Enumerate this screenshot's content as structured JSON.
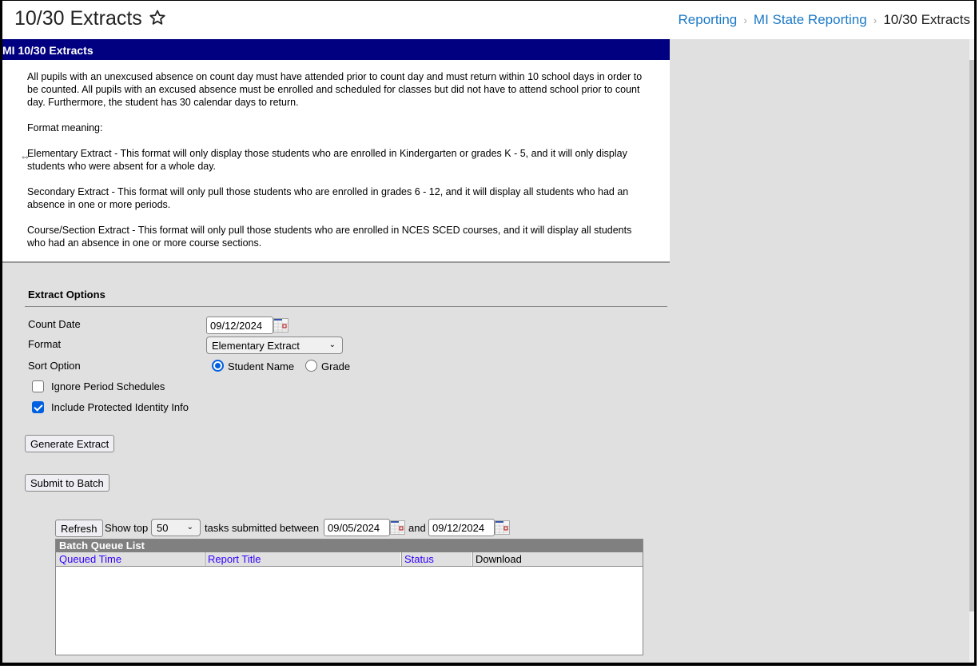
{
  "header": {
    "title": "10/30 Extracts",
    "favorite_icon": "star-outline-icon",
    "breadcrumb": [
      {
        "label": "Reporting"
      },
      {
        "label": "MI State Reporting"
      },
      {
        "label": "10/30 Extracts"
      }
    ],
    "breadcrumb_separator": "›"
  },
  "description": {
    "panel_title": "MI 10/30 Extracts",
    "paragraphs": [
      "All pupils with an unexcused absence on count day must have attended prior to count day and must return within 10 school days in order to be counted. All pupils with an excused absence must be enrolled and scheduled for classes but did not have to attend school prior to count day. Furthermore, the student has 30 calendar days to return.",
      "Format meaning:",
      "Elementary Extract - This format will only display those students who are enrolled in Kindergarten or grades K - 5, and it will only display students who were absent for a whole day.",
      "Secondary Extract - This format will only pull those students who are enrolled in grades 6 - 12, and it will display all students who had an absence in one or more periods.",
      "Course/Section Extract - This format will only pull those students who are enrolled in NCES SCED courses, and it will display all students who had an absence in one or more course sections."
    ]
  },
  "cursor_glyph": "⇔",
  "options": {
    "title": "Extract Options",
    "count_date": {
      "label": "Count Date",
      "value": "09/12/2024"
    },
    "format": {
      "label": "Format",
      "value": "Elementary Extract"
    },
    "sort_option": {
      "label": "Sort Option",
      "choices": [
        {
          "label": "Student Name",
          "selected": true
        },
        {
          "label": "Grade",
          "selected": false
        }
      ]
    },
    "ignore_period_schedules": {
      "label": "Ignore Period Schedules",
      "checked": false
    },
    "include_protected_identity": {
      "label": "Include Protected Identity Info",
      "checked": true
    },
    "generate_button": "Generate Extract",
    "submit_batch_button": "Submit to Batch"
  },
  "batch": {
    "refresh_button": "Refresh",
    "show_top_label": "Show top",
    "show_top_value": "50",
    "submitted_between_label": "tasks submitted between",
    "start_date": "09/05/2024",
    "and_label": "and",
    "end_date": "09/12/2024",
    "queue_title": "Batch Queue List",
    "columns": [
      {
        "label": "Queued Time",
        "sortable": true
      },
      {
        "label": "Report Title",
        "sortable": true
      },
      {
        "label": "Status",
        "sortable": true
      },
      {
        "label": "Download",
        "sortable": false
      }
    ],
    "rows": []
  },
  "colors": {
    "panel_header_bg": "#000080",
    "link": "#1c79c6",
    "queue_title_bg": "#808080",
    "column_link": "#3300ff",
    "accent": "#0060df"
  }
}
